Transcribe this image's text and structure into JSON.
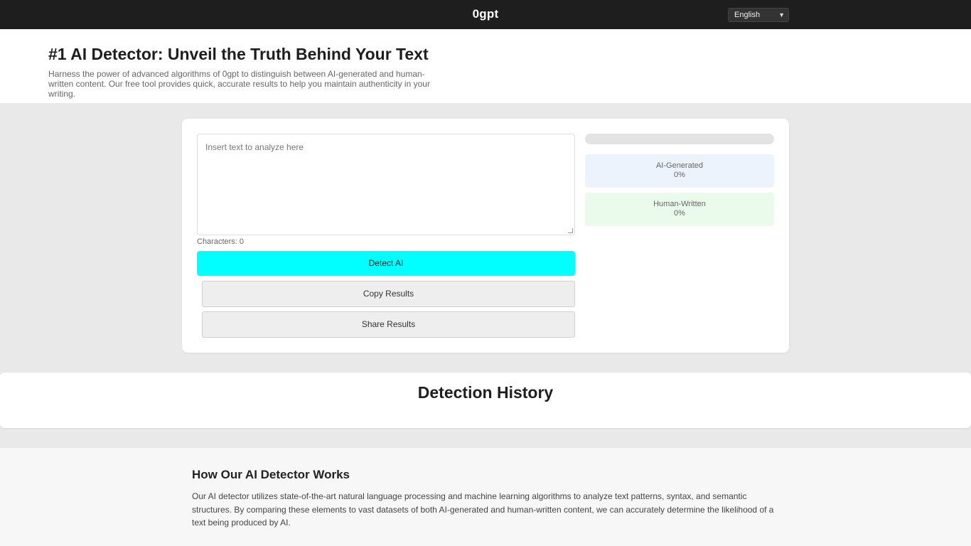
{
  "header": {
    "brand": "0gpt",
    "language": {
      "selected": "English"
    }
  },
  "hero": {
    "title": "#1 AI Detector: Unveil the Truth Behind Your Text",
    "description": "Harness the power of advanced algorithms of 0gpt to distinguish between AI-generated and human-written content. Our free tool provides quick, accurate results to help you maintain authenticity in your writing."
  },
  "detector": {
    "input_placeholder": "Insert text to analyze here",
    "char_count": "Characters: 0",
    "detect_label": "Detect AI",
    "copy_label": "Copy Results",
    "share_label": "Share Results",
    "progress_fraction": 0,
    "ai_label": "AI-Generated",
    "ai_value": "0%",
    "human_label": "Human-Written",
    "human_value": "0%"
  },
  "history": {
    "title": "Detection History"
  },
  "how_it_works": {
    "title": "How Our AI Detector Works",
    "body": "Our AI detector utilizes state-of-the-art natural language processing and machine learning algorithms to analyze text patterns, syntax, and semantic structures. By comparing these elements to vast datasets of both AI-generated and human-written content, we can accurately determine the likelihood of a text being produced by AI."
  },
  "colors": {
    "topbar": "#1e1e1e",
    "detect_button": "#00ffff",
    "ai_box": "#ecf3fd",
    "human_box": "#eafbec"
  }
}
